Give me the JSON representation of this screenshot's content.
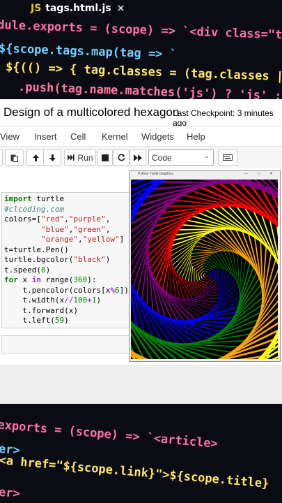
{
  "top_banner": {
    "tab_icon": "JS",
    "tab_title": "tags.html.js",
    "tab_close": "×",
    "lines": [
      "dule.exports = (scope) => `<div class=\"tags\">",
      "${scope.tags.map(tag => `",
      "${(() => { tag.classes = (tag.classes || [])",
      ".push(tag.name.matches('js') ? 'js' : '')"
    ]
  },
  "notebook": {
    "title": "Design of a multicolored hexagon",
    "checkpoint": "Last Checkpoint: 3 minutes ago",
    "menu": [
      "View",
      "Insert",
      "Cell",
      "Kernel",
      "Widgets",
      "Help"
    ],
    "toolbar": {
      "run_label": "Run",
      "cell_type": "Code",
      "icons": [
        "paste-icon",
        "move-up-icon",
        "move-down-icon",
        "run-icon",
        "stop-icon",
        "restart-icon",
        "fast-forward-icon",
        "keyboard-icon"
      ]
    },
    "code": {
      "l1_kw": "import",
      "l1_rest": " turtle",
      "l2": "#clcoding.com",
      "l3a": "colors=[",
      "l3b": "\"red\"",
      "l3c": ",",
      "l3d": "\"purple\"",
      "l3e": ",",
      "l4a": "        ",
      "l4b": "\"blue\"",
      "l4c": ",",
      "l4d": "\"green\"",
      "l4e": ",",
      "l5a": "        ",
      "l5b": "\"orange\"",
      "l5c": ",",
      "l5d": "\"yellow\"",
      "l5e": "]",
      "l6": "t=turtle.Pen()",
      "l7a": "turtle.bgcolor(",
      "l7b": "\"black\"",
      "l7c": ")",
      "l8a": "t.speed(",
      "l8b": "0",
      "l8c": ")",
      "l9a": "for",
      "l9b": " x ",
      "l9c": "in",
      "l9d": " range(",
      "l9e": "360",
      "l9f": "):",
      "l10a": "    t.pencolor(colors[x",
      "l10b": "%",
      "l10c": "6",
      "l10d": "])",
      "l11a": "    t.width(x",
      "l11b": "//",
      "l11c": "100",
      "l11d": "+",
      "l11e": "1",
      "l11f": ")",
      "l12": "    t.forward(x)",
      "l13a": "    t.left(",
      "l13b": "59",
      "l13c": ")"
    }
  },
  "turtle_window": {
    "title": "Python Turtle Graphics",
    "controls": "—  □  ✕",
    "spiral": {
      "steps": 360,
      "turn_degrees": 59,
      "colors": [
        "red",
        "purple",
        "blue",
        "green",
        "orange",
        "yellow"
      ]
    }
  },
  "bottom_banner": {
    "lines": [
      "exports = (scope) => `<article>",
      "er>",
      "<a href=\"${scope.link}\">${scope.title}",
      "er>"
    ]
  }
}
